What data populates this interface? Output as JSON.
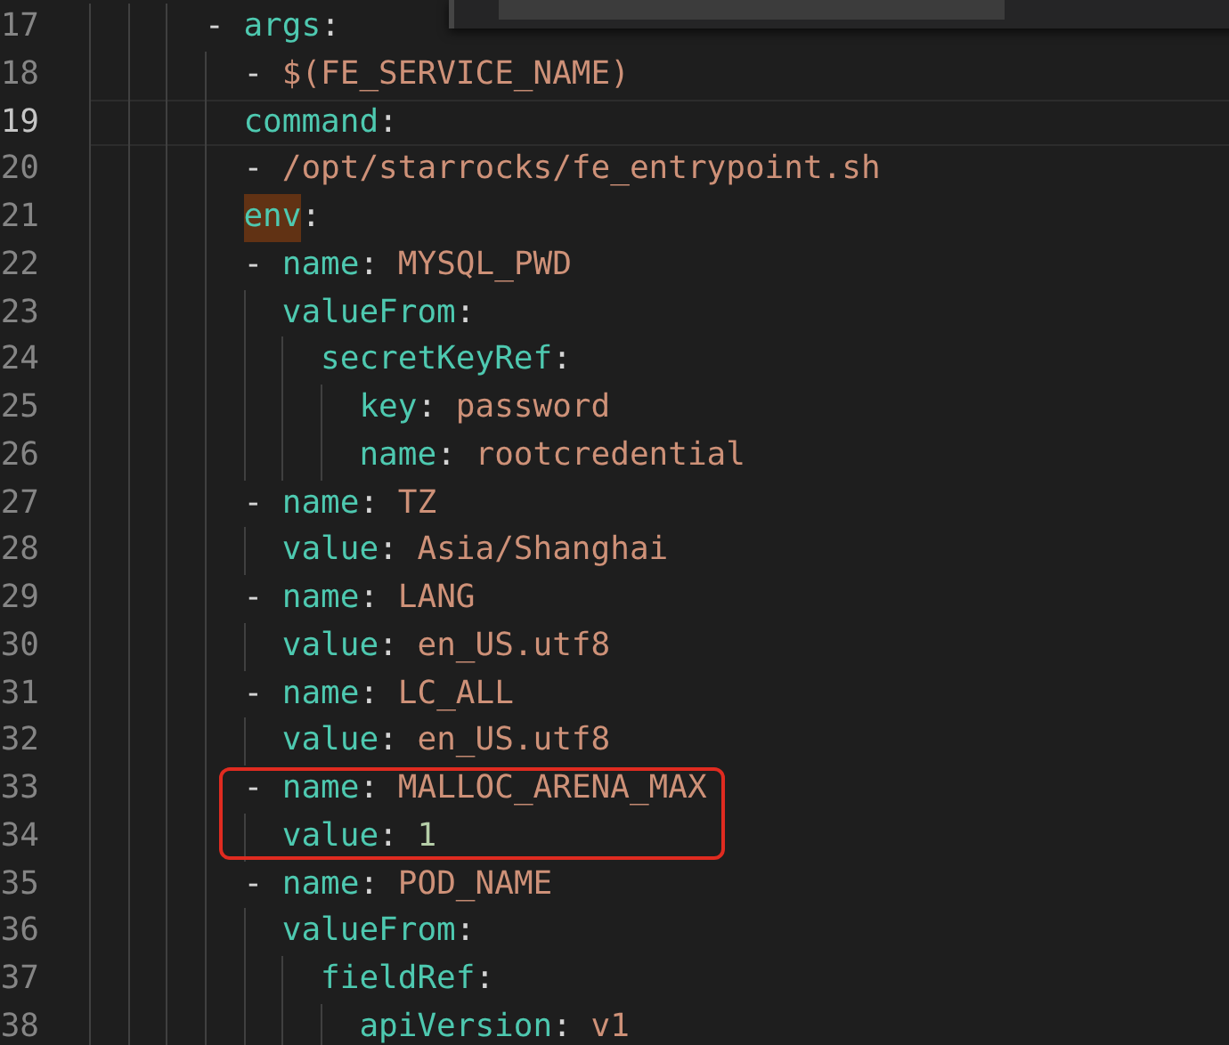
{
  "editor": {
    "lines": [
      {
        "number": "17",
        "current": false,
        "highlighted": false,
        "tokens": [
          {
            "kind": "punct",
            "text": "      - "
          },
          {
            "kind": "key",
            "text": "args"
          },
          {
            "kind": "punct",
            "text": ":"
          }
        ]
      },
      {
        "number": "18",
        "current": false,
        "highlighted": false,
        "tokens": [
          {
            "kind": "punct",
            "text": "        - "
          },
          {
            "kind": "string",
            "text": "$(FE_SERVICE_NAME)"
          }
        ]
      },
      {
        "number": "19",
        "current": true,
        "highlighted": false,
        "tokens": [
          {
            "kind": "key",
            "text": "        command"
          },
          {
            "kind": "punct",
            "text": ":"
          }
        ]
      },
      {
        "number": "20",
        "current": false,
        "highlighted": false,
        "tokens": [
          {
            "kind": "punct",
            "text": "        - "
          },
          {
            "kind": "string",
            "text": "/opt/starrocks/fe_entrypoint.sh"
          }
        ]
      },
      {
        "number": "21",
        "current": false,
        "highlighted": false,
        "tokens": [
          {
            "kind": "key",
            "text": "        env",
            "match": true
          },
          {
            "kind": "punct",
            "text": ":"
          }
        ]
      },
      {
        "number": "22",
        "current": false,
        "highlighted": false,
        "tokens": [
          {
            "kind": "punct",
            "text": "        - "
          },
          {
            "kind": "key",
            "text": "name"
          },
          {
            "kind": "punct",
            "text": ": "
          },
          {
            "kind": "string",
            "text": "MYSQL_PWD"
          }
        ]
      },
      {
        "number": "23",
        "current": false,
        "highlighted": false,
        "tokens": [
          {
            "kind": "key",
            "text": "          valueFrom"
          },
          {
            "kind": "punct",
            "text": ":"
          }
        ]
      },
      {
        "number": "24",
        "current": false,
        "highlighted": false,
        "tokens": [
          {
            "kind": "key",
            "text": "            secretKeyRef"
          },
          {
            "kind": "punct",
            "text": ":"
          }
        ]
      },
      {
        "number": "25",
        "current": false,
        "highlighted": false,
        "tokens": [
          {
            "kind": "key",
            "text": "              key"
          },
          {
            "kind": "punct",
            "text": ": "
          },
          {
            "kind": "string",
            "text": "password"
          }
        ]
      },
      {
        "number": "26",
        "current": false,
        "highlighted": false,
        "tokens": [
          {
            "kind": "key",
            "text": "              name"
          },
          {
            "kind": "punct",
            "text": ": "
          },
          {
            "kind": "string",
            "text": "rootcredential"
          }
        ]
      },
      {
        "number": "27",
        "current": false,
        "highlighted": false,
        "tokens": [
          {
            "kind": "punct",
            "text": "        - "
          },
          {
            "kind": "key",
            "text": "name"
          },
          {
            "kind": "punct",
            "text": ": "
          },
          {
            "kind": "string",
            "text": "TZ"
          }
        ]
      },
      {
        "number": "28",
        "current": false,
        "highlighted": false,
        "tokens": [
          {
            "kind": "key",
            "text": "          value"
          },
          {
            "kind": "punct",
            "text": ": "
          },
          {
            "kind": "string",
            "text": "Asia/Shanghai"
          }
        ]
      },
      {
        "number": "29",
        "current": false,
        "highlighted": false,
        "tokens": [
          {
            "kind": "punct",
            "text": "        - "
          },
          {
            "kind": "key",
            "text": "name"
          },
          {
            "kind": "punct",
            "text": ": "
          },
          {
            "kind": "string",
            "text": "LANG"
          }
        ]
      },
      {
        "number": "30",
        "current": false,
        "highlighted": false,
        "tokens": [
          {
            "kind": "key",
            "text": "          value"
          },
          {
            "kind": "punct",
            "text": ": "
          },
          {
            "kind": "string",
            "text": "en_US.utf8"
          }
        ]
      },
      {
        "number": "31",
        "current": false,
        "highlighted": false,
        "tokens": [
          {
            "kind": "punct",
            "text": "        - "
          },
          {
            "kind": "key",
            "text": "name"
          },
          {
            "kind": "punct",
            "text": ": "
          },
          {
            "kind": "string",
            "text": "LC_ALL"
          }
        ]
      },
      {
        "number": "32",
        "current": false,
        "highlighted": false,
        "tokens": [
          {
            "kind": "key",
            "text": "          value"
          },
          {
            "kind": "punct",
            "text": ": "
          },
          {
            "kind": "string",
            "text": "en_US.utf8"
          }
        ]
      },
      {
        "number": "33",
        "current": false,
        "highlighted": true,
        "tokens": [
          {
            "kind": "punct",
            "text": "        - "
          },
          {
            "kind": "key",
            "text": "name"
          },
          {
            "kind": "punct",
            "text": ": "
          },
          {
            "kind": "string",
            "text": "MALLOC_ARENA_MAX"
          }
        ]
      },
      {
        "number": "34",
        "current": false,
        "highlighted": true,
        "tokens": [
          {
            "kind": "key",
            "text": "          value"
          },
          {
            "kind": "punct",
            "text": ": "
          },
          {
            "kind": "number",
            "text": "1"
          }
        ]
      },
      {
        "number": "35",
        "current": false,
        "highlighted": false,
        "tokens": [
          {
            "kind": "punct",
            "text": "        - "
          },
          {
            "kind": "key",
            "text": "name"
          },
          {
            "kind": "punct",
            "text": ": "
          },
          {
            "kind": "string",
            "text": "POD_NAME"
          }
        ]
      },
      {
        "number": "36",
        "current": false,
        "highlighted": false,
        "tokens": [
          {
            "kind": "key",
            "text": "          valueFrom"
          },
          {
            "kind": "punct",
            "text": ":"
          }
        ]
      },
      {
        "number": "37",
        "current": false,
        "highlighted": false,
        "tokens": [
          {
            "kind": "key",
            "text": "            fieldRef"
          },
          {
            "kind": "punct",
            "text": ":"
          }
        ]
      },
      {
        "number": "38",
        "current": false,
        "highlighted": false,
        "tokens": [
          {
            "kind": "key",
            "text": "              apiVersion"
          },
          {
            "kind": "punct",
            "text": ": "
          },
          {
            "kind": "string",
            "text": "v1"
          }
        ]
      }
    ]
  }
}
